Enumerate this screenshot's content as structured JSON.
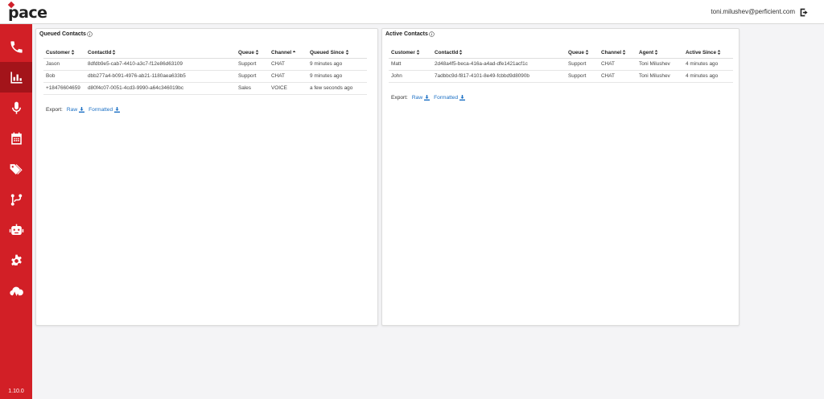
{
  "app": {
    "logo": "pace",
    "version": "1.10.0"
  },
  "header": {
    "user_email": "toni.milushev@perficient.com"
  },
  "sidebar": {
    "items": [
      {
        "name": "phone-icon",
        "active": false
      },
      {
        "name": "bar-chart-icon",
        "active": true
      },
      {
        "name": "microphone-icon",
        "active": false
      },
      {
        "name": "calendar-icon",
        "active": false
      },
      {
        "name": "tags-icon",
        "active": false
      },
      {
        "name": "branch-icon",
        "active": false
      },
      {
        "name": "robot-icon",
        "active": false
      },
      {
        "name": "gear-icon",
        "active": false
      },
      {
        "name": "cloud-pulse-icon",
        "active": false
      }
    ]
  },
  "queued": {
    "title": "Queued Contacts",
    "columns": [
      "Customer",
      "ContactId",
      "Queue",
      "Channel",
      "Queued Since"
    ],
    "rows": [
      [
        "Jason",
        "8dfdb9e5-cab7-4410-a3c7-f12e86d63109",
        "Support",
        "CHAT",
        "9 minutes ago"
      ],
      [
        "Bob",
        "dbb277a4-b091-4976-ab21-1180aea633b5",
        "Support",
        "CHAT",
        "9 minutes ago"
      ],
      [
        "+18476604659",
        "d80f4c07-0051-4cd3-9990-a64c346019bc",
        "Sales",
        "VOICE",
        "a few seconds ago"
      ]
    ],
    "export_label": "Export:",
    "raw_label": "Raw",
    "formatted_label": "Formatted"
  },
  "active": {
    "title": "Active Contacts",
    "columns": [
      "Customer",
      "ContactId",
      "Queue",
      "Channel",
      "Agent",
      "Active Since"
    ],
    "rows": [
      [
        "Matt",
        "2d48a4f5-beca-416a-a4ad-dfe1421acf1c",
        "Support",
        "CHAT",
        "Toni Milushev",
        "4 minutes ago"
      ],
      [
        "John",
        "7adbbc9d-f817-4101-8e49-fcbbd9d8090b",
        "Support",
        "CHAT",
        "Toni Milushev",
        "4 minutes ago"
      ]
    ],
    "export_label": "Export:",
    "raw_label": "Raw",
    "formatted_label": "Formatted"
  }
}
